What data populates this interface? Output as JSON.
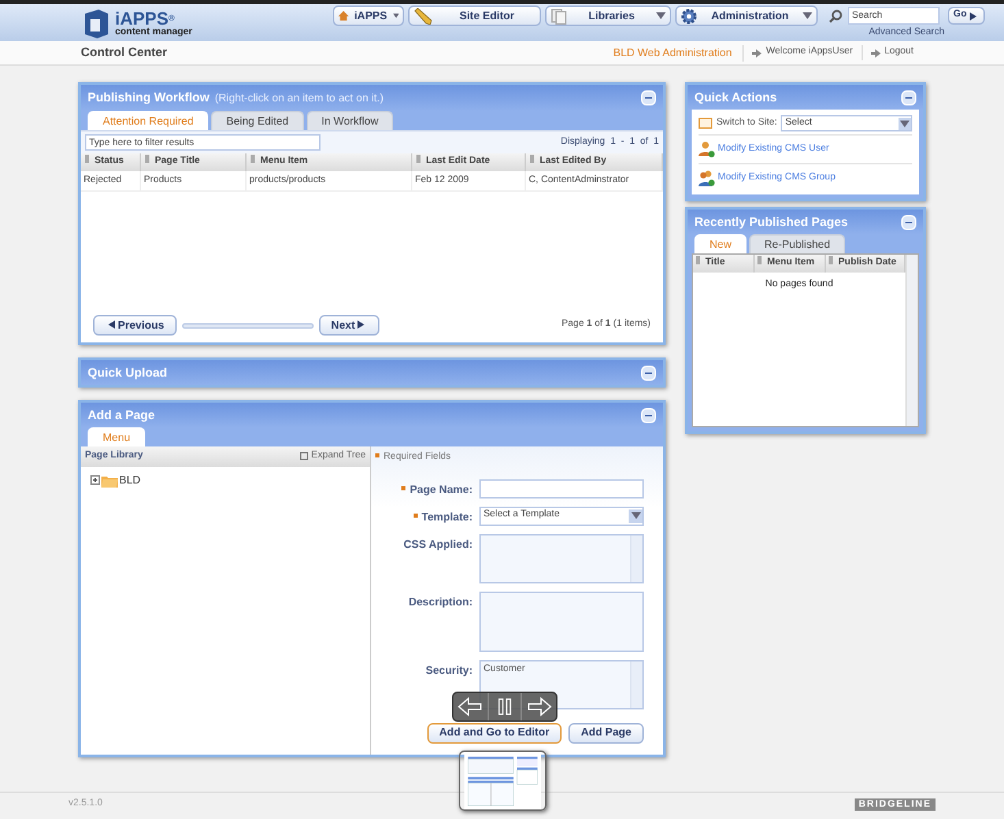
{
  "header": {
    "logo_title": "iAPPS",
    "logo_mark": "®",
    "logo_subtitle": "content manager",
    "nav": [
      {
        "label": "iAPPS",
        "kind": "home",
        "dropdown": true
      },
      {
        "label": "Site Editor",
        "kind": "pencil",
        "dropdown": false
      },
      {
        "label": "Libraries",
        "kind": "pages",
        "dropdown": true
      },
      {
        "label": "Administration",
        "kind": "gear",
        "dropdown": true
      }
    ],
    "search": {
      "placeholder": "Search",
      "button": "Go",
      "link": "Advanced Search"
    }
  },
  "subheader": {
    "title": "Control Center",
    "site": "BLD Web Administration",
    "links": [
      "Welcome iAppsUser",
      "Logout"
    ]
  },
  "workflow": {
    "title": "Publishing Workflow",
    "hint": "(Right-click on an item to act on it.)",
    "tabs": [
      {
        "label": "Attention Required",
        "selected": true
      },
      {
        "label": "Being Edited",
        "selected": false
      },
      {
        "label": "In Workflow",
        "selected": false
      }
    ],
    "filter_placeholder": "Type here to filter results",
    "displaying": "Displaying  1  -  1  of  1",
    "columns": [
      "Status",
      "Page Title",
      "Menu Item",
      "Last Edit Date",
      "Last Edited By"
    ],
    "rows": [
      [
        "Rejected",
        "Products",
        "products/products",
        "Feb 12 2009",
        "C, ContentAdminstrator"
      ]
    ],
    "previous": "Previous",
    "next": "Next",
    "page_info": "Page **1** of **1** (1 items)"
  },
  "quick_upload": {
    "title": "Quick Upload"
  },
  "add_page": {
    "title": "Add a Page",
    "tabs": [
      {
        "label": "Menu",
        "selected": true
      }
    ],
    "library_title": "Page Library",
    "expand": "Expand Tree",
    "tree": [
      {
        "label": "BLD",
        "expanded": false
      }
    ],
    "required_note": "Required Fields",
    "fields": [
      {
        "label": "Page Name:",
        "kind": "text",
        "required": true
      },
      {
        "label": "Template:",
        "kind": "select",
        "required": true,
        "value": "Select a Template"
      },
      {
        "label": "CSS Applied:",
        "kind": "list",
        "required": false
      },
      {
        "label": "Description:",
        "kind": "textarea",
        "required": false
      },
      {
        "label": "Security:",
        "kind": "list",
        "required": false,
        "options": [
          "Customer"
        ]
      }
    ],
    "buttons": [
      {
        "label": "Add and Go to Editor",
        "selected": true
      },
      {
        "label": "Add Page",
        "selected": false
      }
    ]
  },
  "quick_actions": {
    "title": "Quick Actions",
    "switch_label": "Switch to Site:",
    "switch_value": "Select",
    "links": [
      {
        "label": "Modify Existing CMS User",
        "kind": "user"
      },
      {
        "label": "Modify Existing CMS Group",
        "kind": "group"
      }
    ]
  },
  "recent": {
    "title": "Recently Published Pages",
    "tabs": [
      {
        "label": "New",
        "selected": true
      },
      {
        "label": "Re-Published",
        "selected": false
      }
    ],
    "columns": [
      "Title",
      "Menu Item",
      "Publish Date"
    ],
    "empty": "No pages found"
  },
  "footer": {
    "version": "v2.5.1.0",
    "logo": "BRIDGELINE"
  }
}
